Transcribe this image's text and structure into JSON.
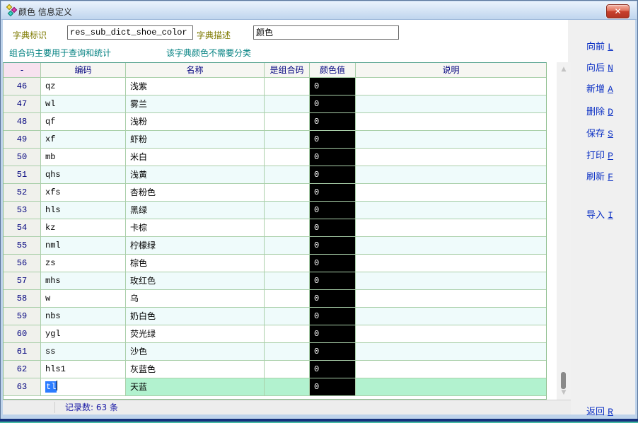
{
  "window": {
    "title": "颜色 信息定义",
    "close_glyph": "✕"
  },
  "form": {
    "dict_id_label": "字典标识",
    "dict_id_value": "res_sub_dict_shoe_color",
    "dict_desc_label": "字典描述",
    "dict_desc_value": "颜色",
    "hint_combo": "组合码主要用于查询和统计",
    "hint_category": "该字典颜色不需要分类"
  },
  "table": {
    "headers": [
      "-",
      "编码",
      "名称",
      "是组合码",
      "颜色值",
      "说明"
    ],
    "rows": [
      {
        "num": "46",
        "code": "qz",
        "name": "浅紫",
        "is_combo": "",
        "color_value": "0",
        "note": "",
        "selected": false
      },
      {
        "num": "47",
        "code": "wl",
        "name": "雾兰",
        "is_combo": "",
        "color_value": "0",
        "note": "",
        "selected": false
      },
      {
        "num": "48",
        "code": "qf",
        "name": "浅粉",
        "is_combo": "",
        "color_value": "0",
        "note": "",
        "selected": false
      },
      {
        "num": "49",
        "code": "xf",
        "name": "虾粉",
        "is_combo": "",
        "color_value": "0",
        "note": "",
        "selected": false
      },
      {
        "num": "50",
        "code": "mb",
        "name": "米白",
        "is_combo": "",
        "color_value": "0",
        "note": "",
        "selected": false
      },
      {
        "num": "51",
        "code": "qhs",
        "name": "浅黄",
        "is_combo": "",
        "color_value": "0",
        "note": "",
        "selected": false
      },
      {
        "num": "52",
        "code": "xfs",
        "name": "杏粉色",
        "is_combo": "",
        "color_value": "0",
        "note": "",
        "selected": false
      },
      {
        "num": "53",
        "code": "hls",
        "name": "黑绿",
        "is_combo": "",
        "color_value": "0",
        "note": "",
        "selected": false
      },
      {
        "num": "54",
        "code": "kz",
        "name": "卡棕",
        "is_combo": "",
        "color_value": "0",
        "note": "",
        "selected": false
      },
      {
        "num": "55",
        "code": "nml",
        "name": "柠檬绿",
        "is_combo": "",
        "color_value": "0",
        "note": "",
        "selected": false
      },
      {
        "num": "56",
        "code": "zs",
        "name": "棕色",
        "is_combo": "",
        "color_value": "0",
        "note": "",
        "selected": false
      },
      {
        "num": "57",
        "code": "mhs",
        "name": "玫红色",
        "is_combo": "",
        "color_value": "0",
        "note": "",
        "selected": false
      },
      {
        "num": "58",
        "code": "w",
        "name": "乌",
        "is_combo": "",
        "color_value": "0",
        "note": "",
        "selected": false
      },
      {
        "num": "59",
        "code": "nbs",
        "name": "奶白色",
        "is_combo": "",
        "color_value": "0",
        "note": "",
        "selected": false
      },
      {
        "num": "60",
        "code": "ygl",
        "name": "荧光绿",
        "is_combo": "",
        "color_value": "0",
        "note": "",
        "selected": false
      },
      {
        "num": "61",
        "code": "ss",
        "name": "沙色",
        "is_combo": "",
        "color_value": "0",
        "note": "",
        "selected": false
      },
      {
        "num": "62",
        "code": "hls1",
        "name": "灰蓝色",
        "is_combo": "",
        "color_value": "0",
        "note": "",
        "selected": false
      },
      {
        "num": "63",
        "code": "tl",
        "name": "天蓝",
        "is_combo": "",
        "color_value": "0",
        "note": "",
        "selected": true
      }
    ]
  },
  "actions": {
    "items": [
      {
        "name": "forward",
        "text": "向前",
        "key": "L"
      },
      {
        "name": "next",
        "text": "向后",
        "key": "N"
      },
      {
        "name": "add",
        "text": "新增",
        "key": "A"
      },
      {
        "name": "delete",
        "text": "删除",
        "key": "D"
      },
      {
        "name": "save",
        "text": "保存",
        "key": "S"
      },
      {
        "name": "print",
        "text": "打印",
        "key": "P"
      },
      {
        "name": "refresh",
        "text": "刷新",
        "key": "F"
      },
      {
        "name": "import",
        "text": "导入",
        "key": "I"
      }
    ],
    "back": {
      "name": "back",
      "text": "返回",
      "key": "R"
    }
  },
  "status": {
    "record_count": "记录数: 63 条"
  },
  "colors": {
    "selection_blue": "#2b7cff",
    "selected_row_green": "#b2f2cf",
    "grid_line_green": "#a9cfa9",
    "header_navy": "#00007e",
    "link_blue": "#0a2fc4",
    "hint_teal": "#008080",
    "label_olive": "#7e7a00",
    "value_cell_black": "#000000"
  }
}
